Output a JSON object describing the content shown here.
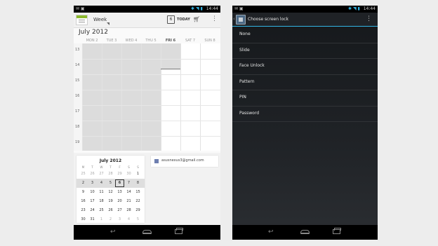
{
  "left_screen": {
    "status": {
      "left_icons": "✉ ▣",
      "time": "14:44"
    },
    "action_bar": {
      "view_label": "Week",
      "today_day": "6",
      "today_label": "TODAY"
    },
    "month_title": "July 2012",
    "week_days": [
      "MON 2",
      "TUE 3",
      "WED 4",
      "THU 5",
      "FRI 6",
      "SAT 7",
      "SUN 8"
    ],
    "hours": [
      "13",
      "14",
      "15",
      "16",
      "17",
      "18",
      "19"
    ],
    "mini_calendar": {
      "title": "July 2012",
      "dow": [
        "M",
        "T",
        "W",
        "T",
        "F",
        "S",
        "S"
      ],
      "weeks": [
        [
          "25",
          "26",
          "27",
          "28",
          "29",
          "30",
          "1"
        ],
        [
          "2",
          "3",
          "4",
          "5",
          "6",
          "7",
          "8"
        ],
        [
          "9",
          "10",
          "11",
          "12",
          "13",
          "14",
          "15"
        ],
        [
          "16",
          "17",
          "18",
          "19",
          "20",
          "21",
          "22"
        ],
        [
          "23",
          "24",
          "25",
          "26",
          "27",
          "28",
          "29"
        ],
        [
          "30",
          "31",
          "1",
          "2",
          "3",
          "4",
          "5"
        ]
      ],
      "selected": "6"
    },
    "account": {
      "email": "asusnexus3@gmail.com",
      "color": "#6e7fb0"
    }
  },
  "right_screen": {
    "status": {
      "left_icons": "✉ ▣",
      "time": "14:44"
    },
    "title": "Choose screen lock",
    "options": [
      "None",
      "Slide",
      "Face Unlock",
      "Pattern",
      "PIN",
      "Password"
    ],
    "accent_color": "#33b5e5"
  },
  "nav_icons": [
    "back-icon",
    "home-icon",
    "recents-icon"
  ]
}
